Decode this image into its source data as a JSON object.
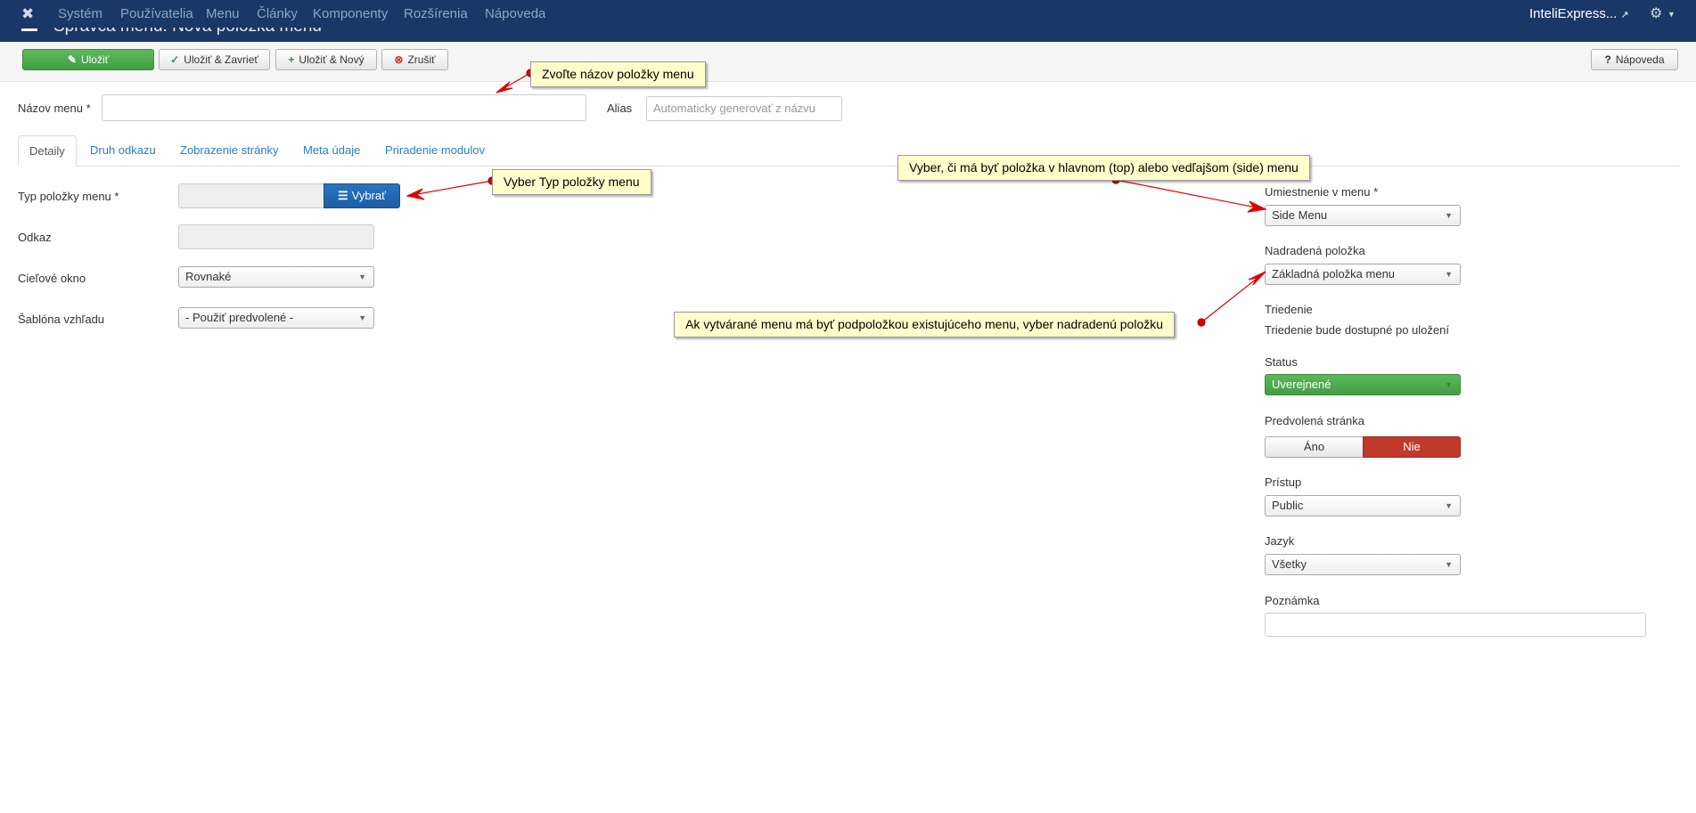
{
  "topnav": {
    "items": [
      "Systém",
      "Používatelia",
      "Menu",
      "Články",
      "Komponenty",
      "Rozšírenia",
      "Nápoveda"
    ],
    "site_link": "InteliExpress...",
    "site_link_icon": "external-link-icon",
    "settings_icon": "gear-icon"
  },
  "page": {
    "title": "Správca menu: Nová položka menu"
  },
  "toolbar": {
    "save_label": "Uložiť",
    "save_close_label": "Uložiť & Zavrieť",
    "save_new_label": "Uložiť & Nový",
    "cancel_label": "Zrušiť",
    "help_label": "Nápoveda"
  },
  "form": {
    "title_label": "Názov menu *",
    "title_value": "",
    "alias_label": "Alias",
    "alias_placeholder": "Automaticky generovať z názvu"
  },
  "tabs": [
    "Detaily",
    "Druh odkazu",
    "Zobrazenie stránky",
    "Meta údaje",
    "Priradenie modulov"
  ],
  "details": {
    "type_label": "Typ položky menu *",
    "select_button": "Vybrať",
    "link_label": "Odkaz",
    "target_label": "Cieľové okno",
    "target_value": "Rovnaké",
    "template_label": "Šablóna vzhľadu",
    "template_value": "- Použiť predvolené -"
  },
  "sidebar": {
    "menu_label": "Umiestnenie v menu *",
    "menu_value": "Side Menu",
    "parent_label": "Nadradená položka",
    "parent_value": "Základná položka menu",
    "ordering_label": "Triedenie",
    "ordering_text": "Triedenie bude dostupné po uložení",
    "status_label": "Status",
    "status_value": "Uverejnené",
    "home_label": "Predvolená stránka",
    "home_yes": "Áno",
    "home_no": "Nie",
    "access_label": "Prístup",
    "access_value": "Public",
    "language_label": "Jazyk",
    "language_value": "Všetky",
    "note_label": "Poznámka",
    "note_value": ""
  },
  "callouts": {
    "name": "Zvoľte názov položky menu",
    "type": "Vyber Typ položky menu",
    "menu": "Vyber, či má byť položka v hlavnom (top) alebo vedľajšom (side) menu",
    "parent": "Ak vytvárané menu má byť podpoložkou existujúceho menu, vyber nadradenú položku"
  },
  "colors": {
    "navbar": "#1a3867",
    "save_green": "#4cae4c",
    "select_blue": "#1c5ea6",
    "no_red": "#c0392b",
    "callout_bg": "#ffffcc",
    "arrow_red": "#e00000"
  }
}
